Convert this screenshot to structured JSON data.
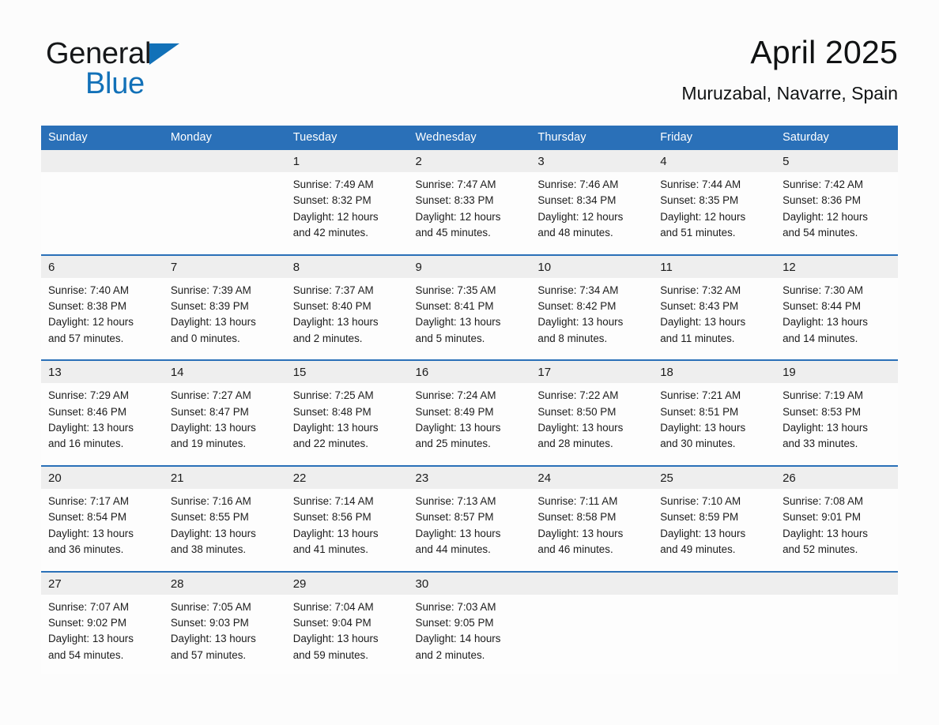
{
  "brand": {
    "name_part1": "General",
    "name_part2": "Blue",
    "triangle_icon": "triangle-icon",
    "colors": {
      "black": "#16181a",
      "blue": "#1271b8"
    }
  },
  "header": {
    "title": "April 2025",
    "subtitle": "Muruzabal, Navarre, Spain"
  },
  "theme": {
    "header_blue": "#2a70b8",
    "daynum_band": "#eeeeee",
    "cell_background": "#fdfdfd",
    "page_background": "#fcfcfc",
    "text": "#1c1c1c"
  },
  "weekday_headers": [
    "Sunday",
    "Monday",
    "Tuesday",
    "Wednesday",
    "Thursday",
    "Friday",
    "Saturday"
  ],
  "weeks": [
    [
      {
        "day": "",
        "empty": true,
        "details": ""
      },
      {
        "day": "",
        "empty": true,
        "details": ""
      },
      {
        "day": "1",
        "empty": false,
        "details": "Sunrise: 7:49 AM\nSunset: 8:32 PM\nDaylight: 12 hours\nand 42 minutes."
      },
      {
        "day": "2",
        "empty": false,
        "details": "Sunrise: 7:47 AM\nSunset: 8:33 PM\nDaylight: 12 hours\nand 45 minutes."
      },
      {
        "day": "3",
        "empty": false,
        "details": "Sunrise: 7:46 AM\nSunset: 8:34 PM\nDaylight: 12 hours\nand 48 minutes."
      },
      {
        "day": "4",
        "empty": false,
        "details": "Sunrise: 7:44 AM\nSunset: 8:35 PM\nDaylight: 12 hours\nand 51 minutes."
      },
      {
        "day": "5",
        "empty": false,
        "details": "Sunrise: 7:42 AM\nSunset: 8:36 PM\nDaylight: 12 hours\nand 54 minutes."
      }
    ],
    [
      {
        "day": "6",
        "empty": false,
        "details": "Sunrise: 7:40 AM\nSunset: 8:38 PM\nDaylight: 12 hours\nand 57 minutes."
      },
      {
        "day": "7",
        "empty": false,
        "details": "Sunrise: 7:39 AM\nSunset: 8:39 PM\nDaylight: 13 hours\nand 0 minutes."
      },
      {
        "day": "8",
        "empty": false,
        "details": "Sunrise: 7:37 AM\nSunset: 8:40 PM\nDaylight: 13 hours\nand 2 minutes."
      },
      {
        "day": "9",
        "empty": false,
        "details": "Sunrise: 7:35 AM\nSunset: 8:41 PM\nDaylight: 13 hours\nand 5 minutes."
      },
      {
        "day": "10",
        "empty": false,
        "details": "Sunrise: 7:34 AM\nSunset: 8:42 PM\nDaylight: 13 hours\nand 8 minutes."
      },
      {
        "day": "11",
        "empty": false,
        "details": "Sunrise: 7:32 AM\nSunset: 8:43 PM\nDaylight: 13 hours\nand 11 minutes."
      },
      {
        "day": "12",
        "empty": false,
        "details": "Sunrise: 7:30 AM\nSunset: 8:44 PM\nDaylight: 13 hours\nand 14 minutes."
      }
    ],
    [
      {
        "day": "13",
        "empty": false,
        "details": "Sunrise: 7:29 AM\nSunset: 8:46 PM\nDaylight: 13 hours\nand 16 minutes."
      },
      {
        "day": "14",
        "empty": false,
        "details": "Sunrise: 7:27 AM\nSunset: 8:47 PM\nDaylight: 13 hours\nand 19 minutes."
      },
      {
        "day": "15",
        "empty": false,
        "details": "Sunrise: 7:25 AM\nSunset: 8:48 PM\nDaylight: 13 hours\nand 22 minutes."
      },
      {
        "day": "16",
        "empty": false,
        "details": "Sunrise: 7:24 AM\nSunset: 8:49 PM\nDaylight: 13 hours\nand 25 minutes."
      },
      {
        "day": "17",
        "empty": false,
        "details": "Sunrise: 7:22 AM\nSunset: 8:50 PM\nDaylight: 13 hours\nand 28 minutes."
      },
      {
        "day": "18",
        "empty": false,
        "details": "Sunrise: 7:21 AM\nSunset: 8:51 PM\nDaylight: 13 hours\nand 30 minutes."
      },
      {
        "day": "19",
        "empty": false,
        "details": "Sunrise: 7:19 AM\nSunset: 8:53 PM\nDaylight: 13 hours\nand 33 minutes."
      }
    ],
    [
      {
        "day": "20",
        "empty": false,
        "details": "Sunrise: 7:17 AM\nSunset: 8:54 PM\nDaylight: 13 hours\nand 36 minutes."
      },
      {
        "day": "21",
        "empty": false,
        "details": "Sunrise: 7:16 AM\nSunset: 8:55 PM\nDaylight: 13 hours\nand 38 minutes."
      },
      {
        "day": "22",
        "empty": false,
        "details": "Sunrise: 7:14 AM\nSunset: 8:56 PM\nDaylight: 13 hours\nand 41 minutes."
      },
      {
        "day": "23",
        "empty": false,
        "details": "Sunrise: 7:13 AM\nSunset: 8:57 PM\nDaylight: 13 hours\nand 44 minutes."
      },
      {
        "day": "24",
        "empty": false,
        "details": "Sunrise: 7:11 AM\nSunset: 8:58 PM\nDaylight: 13 hours\nand 46 minutes."
      },
      {
        "day": "25",
        "empty": false,
        "details": "Sunrise: 7:10 AM\nSunset: 8:59 PM\nDaylight: 13 hours\nand 49 minutes."
      },
      {
        "day": "26",
        "empty": false,
        "details": "Sunrise: 7:08 AM\nSunset: 9:01 PM\nDaylight: 13 hours\nand 52 minutes."
      }
    ],
    [
      {
        "day": "27",
        "empty": false,
        "details": "Sunrise: 7:07 AM\nSunset: 9:02 PM\nDaylight: 13 hours\nand 54 minutes."
      },
      {
        "day": "28",
        "empty": false,
        "details": "Sunrise: 7:05 AM\nSunset: 9:03 PM\nDaylight: 13 hours\nand 57 minutes."
      },
      {
        "day": "29",
        "empty": false,
        "details": "Sunrise: 7:04 AM\nSunset: 9:04 PM\nDaylight: 13 hours\nand 59 minutes."
      },
      {
        "day": "30",
        "empty": false,
        "details": "Sunrise: 7:03 AM\nSunset: 9:05 PM\nDaylight: 14 hours\nand 2 minutes."
      },
      {
        "day": "",
        "empty": true,
        "details": ""
      },
      {
        "day": "",
        "empty": true,
        "details": ""
      },
      {
        "day": "",
        "empty": true,
        "details": ""
      }
    ]
  ]
}
